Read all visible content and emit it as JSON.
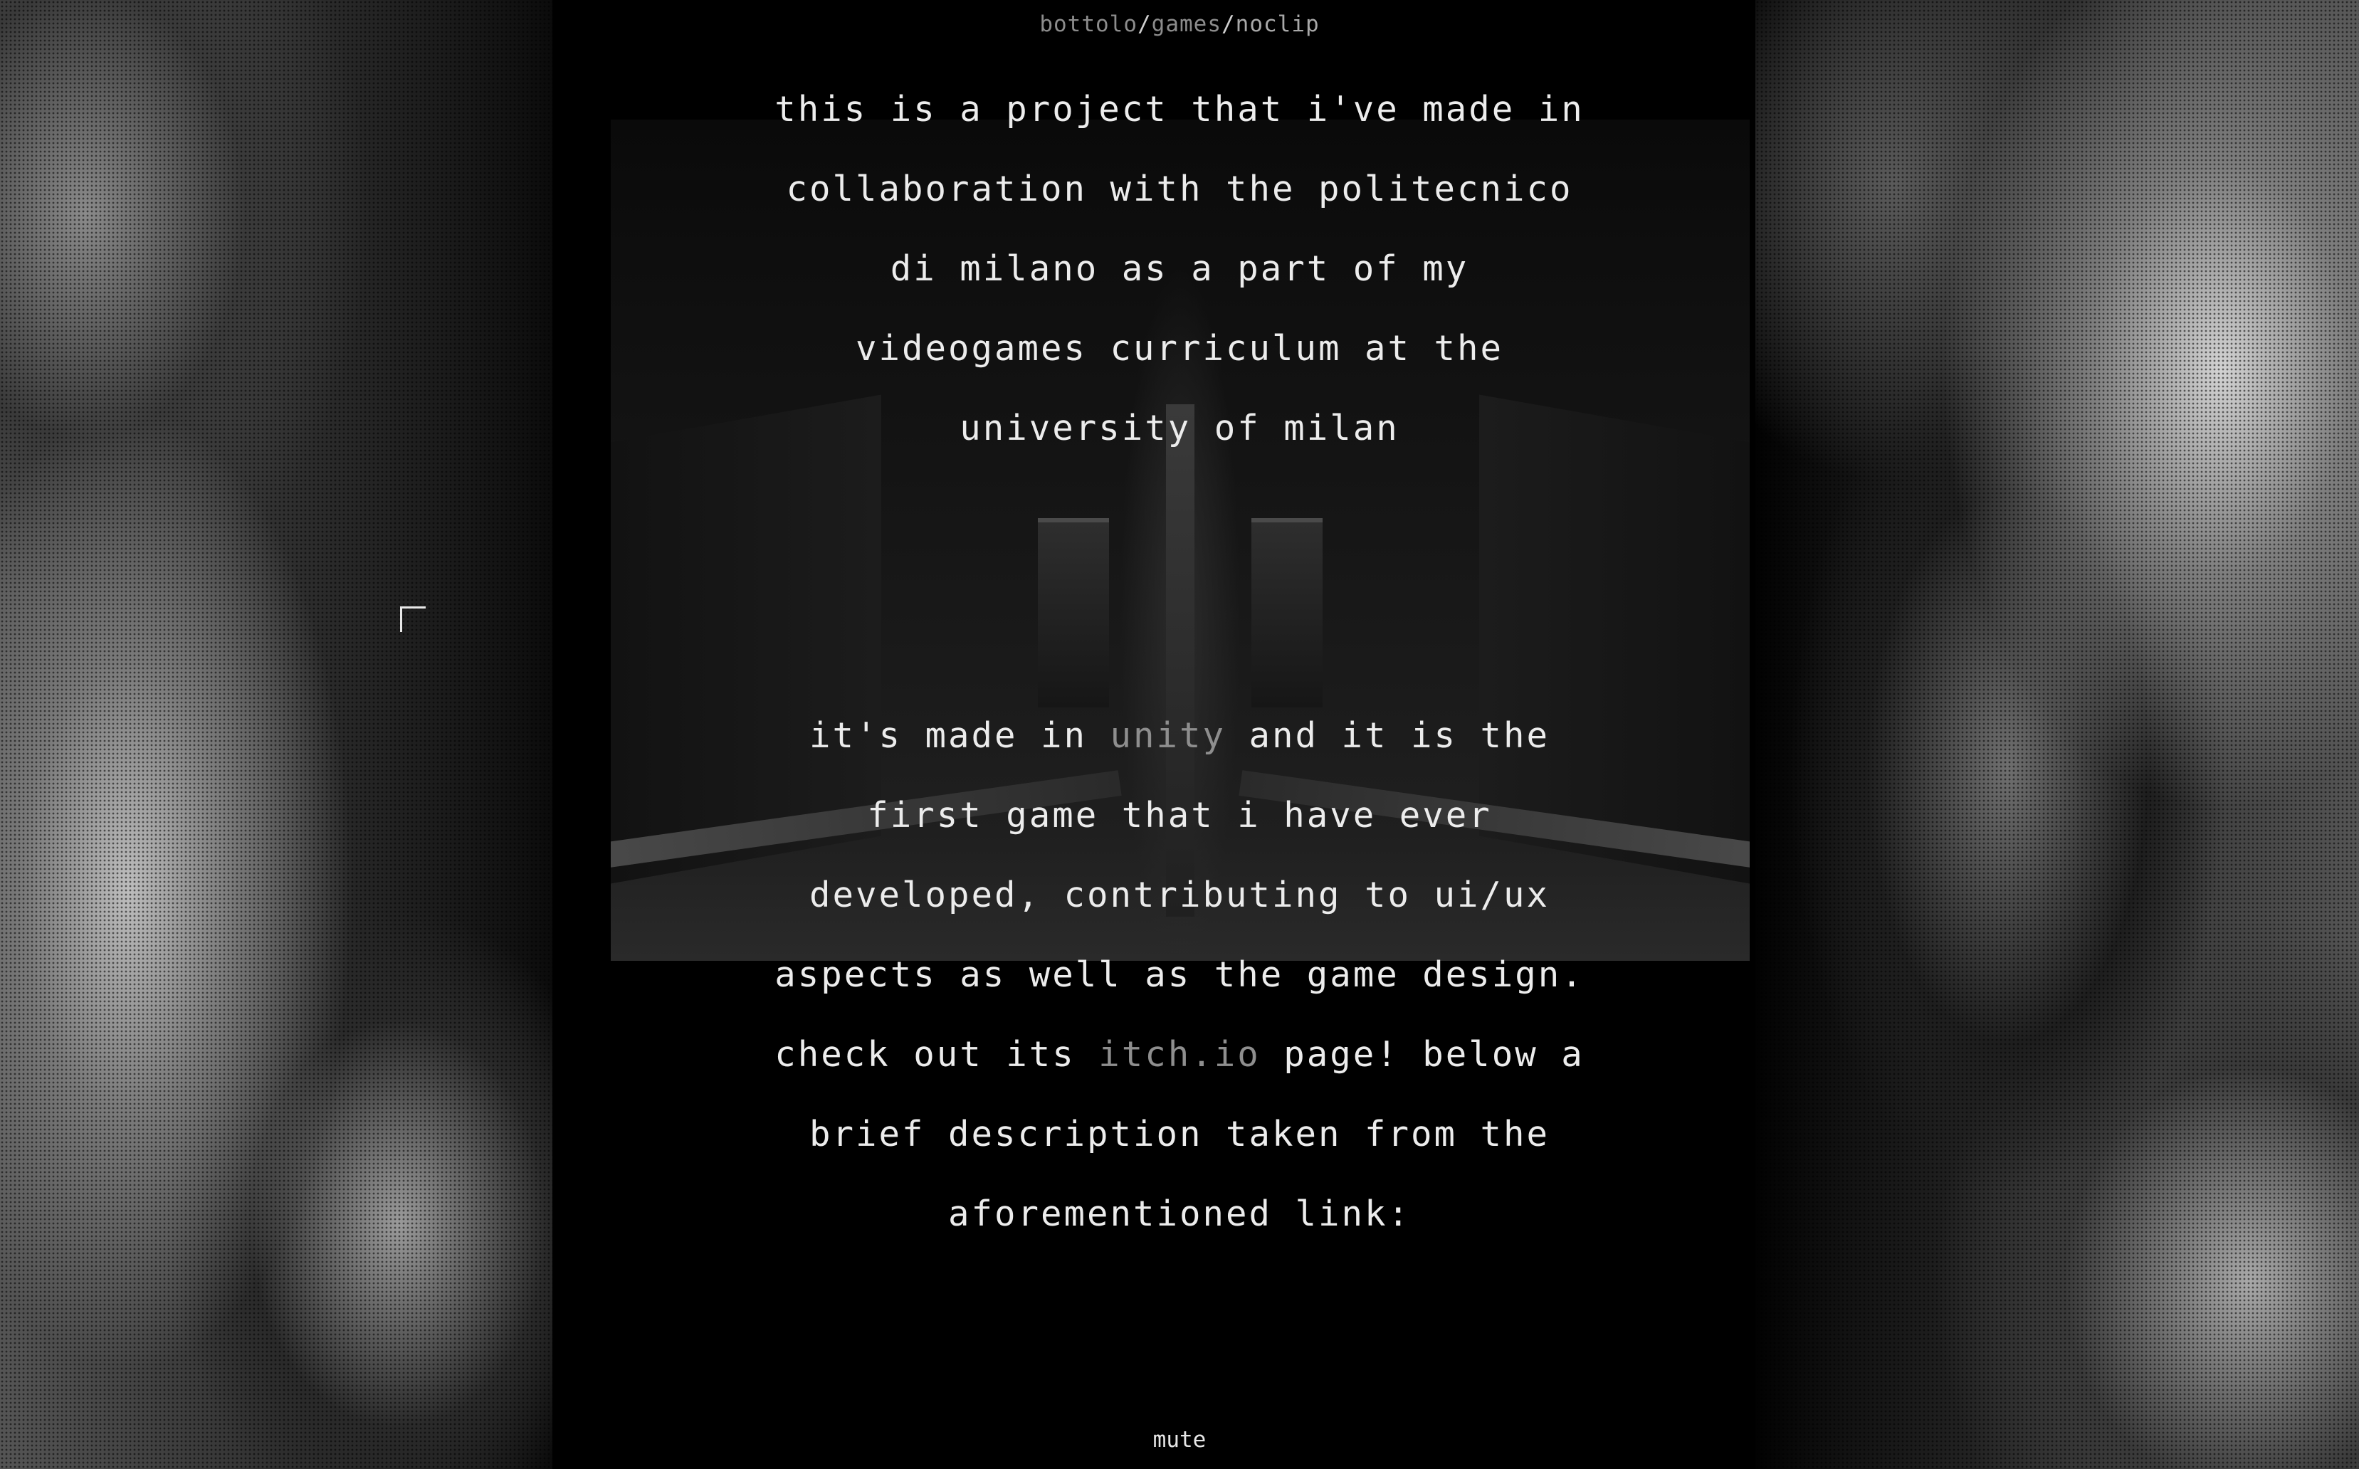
{
  "breadcrumb": {
    "items": [
      "bottolo",
      "games",
      "noclip"
    ],
    "separator": "/"
  },
  "intro": {
    "lines": [
      "this is a project that i've made in",
      "collaboration with the politecnico",
      "di milano as a part of my",
      "videogames curriculum at the",
      "university of milan"
    ]
  },
  "details": {
    "line1_before": "it's made in ",
    "line1_link": "unity",
    "line1_after": " and it is the",
    "line2": "first game that i have ever",
    "line3": "developed, contributing to ui/ux",
    "line4": "aspects as well as the game design.",
    "line5_before": "check out its ",
    "line5_link": "itch.io",
    "line5_after": " page! below a",
    "line6": "brief description taken from the",
    "line7": "aforementioned link:"
  },
  "footer": {
    "mute_label": "mute"
  },
  "colors": {
    "background": "#000000",
    "text": "#ececec",
    "link": "#8e8e8e",
    "breadcrumb": "#8c8c8c"
  },
  "icons": {
    "cursor": "corner-cursor-icon"
  }
}
